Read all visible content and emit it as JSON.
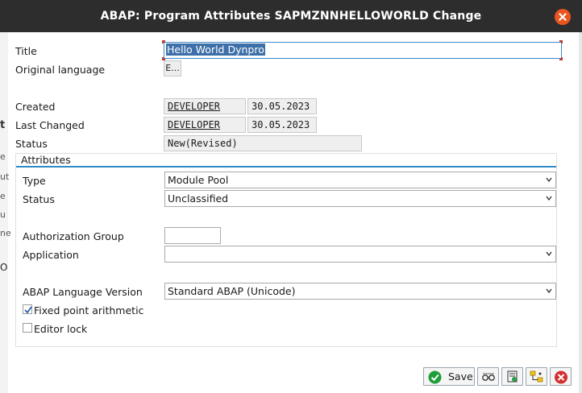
{
  "window": {
    "title": "ABAP: Program Attributes SAPMZNNHELLOWORLD Change"
  },
  "fields": {
    "title_label": "Title",
    "title_value": "Hello World Dynpro",
    "orig_lang_label": "Original language",
    "orig_lang_value": "E...",
    "created_label": "Created",
    "created_user": "DEVELOPER",
    "created_date": "30.05.2023",
    "last_changed_label": "Last Changed",
    "last_changed_user": "DEVELOPER",
    "last_changed_date": "30.05.2023",
    "status_label": "Status",
    "status_value": "New(Revised)"
  },
  "attributes": {
    "heading": "Attributes",
    "type_label": "Type",
    "type_value": "Module Pool",
    "status_label": "Status",
    "status_value": "Unclassified",
    "auth_group_label": "Authorization Group",
    "auth_group_value": "",
    "application_label": "Application",
    "application_value": "",
    "abap_version_label": "ABAP Language Version",
    "abap_version_value": "Standard ABAP (Unicode)",
    "fixed_point_label": "Fixed point arithmetic",
    "fixed_point_checked": true,
    "editor_lock_label": "Editor lock",
    "editor_lock_checked": false
  },
  "toolbar": {
    "save_label": "Save",
    "icons": [
      "save-icon",
      "glasses-icon",
      "display-object-icon",
      "object-tree-icon",
      "cancel-icon"
    ]
  },
  "background_fragments": [
    "t",
    "e",
    "ut",
    "e",
    "u",
    "ne",
    "O"
  ],
  "colors": {
    "titlebar": "#2d2d2d",
    "close": "#e95420",
    "accent": "#2f8ac6",
    "selection": "#3d6fa8"
  }
}
